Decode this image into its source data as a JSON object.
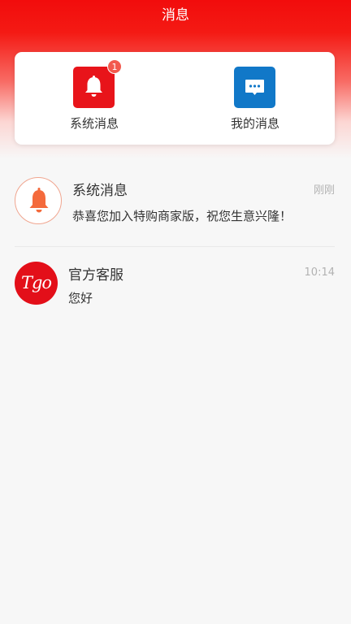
{
  "header": {
    "title": "消息"
  },
  "quick": {
    "system": {
      "label": "系统消息",
      "badge": "1",
      "icon": "bell-icon",
      "color": "#e8141a"
    },
    "mine": {
      "label": "我的消息",
      "icon": "chat-bubble-icon",
      "color": "#1178c8"
    }
  },
  "messages": [
    {
      "title": "系统消息",
      "time": "刚刚",
      "text": "恭喜您加入特购商家版，祝您生意兴隆！",
      "avatar": "bell-icon"
    },
    {
      "title": "官方客服",
      "time": "10:14",
      "text": "您好",
      "avatar_text": "Tgo"
    }
  ],
  "colors": {
    "brand_red": "#f20c0c",
    "accent_blue": "#1178c8",
    "badge": "#f25a4e"
  }
}
